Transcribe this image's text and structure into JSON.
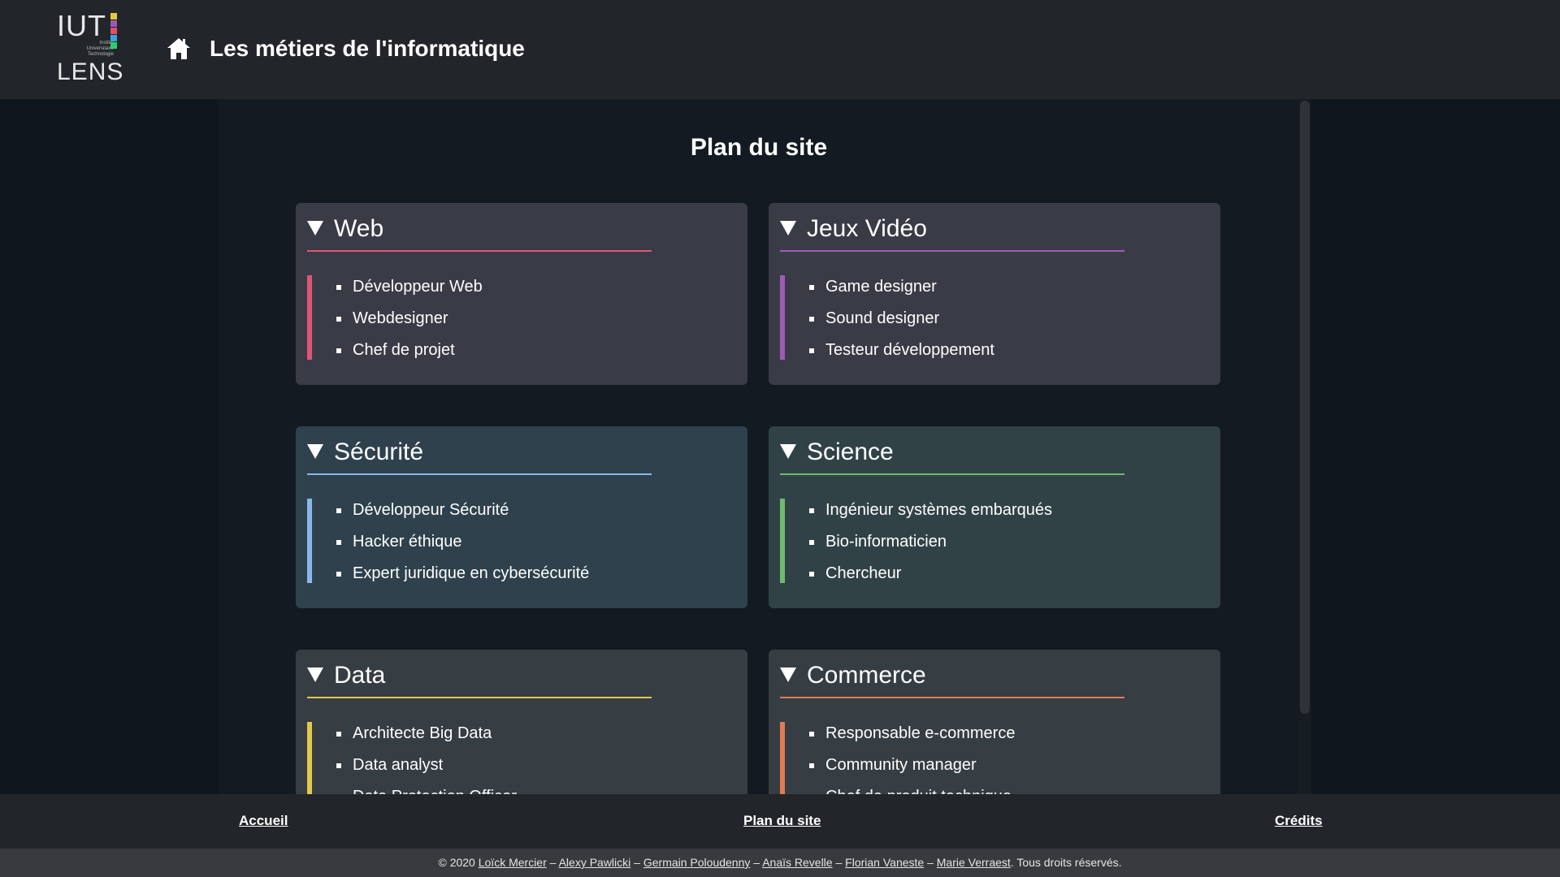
{
  "header": {
    "logo": {
      "line1": "IUT",
      "line2": "LENS",
      "small": [
        "Institut",
        "Universitaire",
        "Technologie"
      ],
      "bar_colors": [
        "#e5c93a",
        "#9b59b6",
        "#e74c6f",
        "#3aa7d8",
        "#2ecc71"
      ]
    },
    "icon": "home-icon",
    "title": "Les métiers de l'informatique"
  },
  "main": {
    "heading": "Plan du site",
    "sections": [
      {
        "title": "Web",
        "accent": "#e05576",
        "items": [
          "Développeur Web",
          "Webdesigner",
          "Chef de projet"
        ]
      },
      {
        "title": "Jeux Vidéo",
        "accent": "#9e5bb4",
        "items": [
          "Game designer",
          "Sound designer",
          "Testeur développement"
        ]
      },
      {
        "title": "Sécurité",
        "accent": "#8ab8e8",
        "items": [
          "Développeur Sécurité",
          "Hacker éthique",
          "Expert juridique en cybersécurité"
        ]
      },
      {
        "title": "Science",
        "accent": "#6dbb6d",
        "items": [
          "Ingénieur systèmes embarqués",
          "Bio-informaticien",
          "Chercheur"
        ]
      },
      {
        "title": "Data",
        "accent": "#e3c84c",
        "items": [
          "Architecte Big Data",
          "Data analyst",
          "Data Protection Officer"
        ]
      },
      {
        "title": "Commerce",
        "accent": "#e07a57",
        "items": [
          "Responsable e-commerce",
          "Community manager",
          "Chef de produit technique"
        ]
      }
    ]
  },
  "footer": {
    "nav": {
      "home": "Accueil",
      "sitemap": "Plan du site",
      "credits": "Crédits"
    },
    "copyright_prefix": "© 2020",
    "authors": [
      "Loïck Mercier",
      "Alexy Pawlicki",
      "Germain Poloudenny",
      "Anaïs Revelle",
      "Florian Vaneste",
      "Marie Verraest"
    ],
    "separator": "–",
    "rights": "Tous droits réservés."
  }
}
